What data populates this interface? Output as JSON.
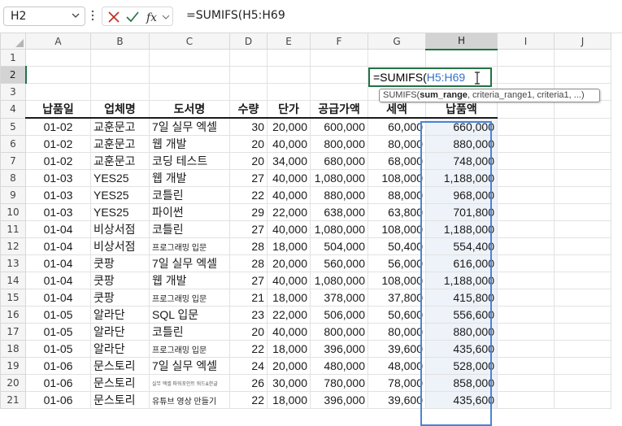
{
  "formula_bar": {
    "name_box": "H2",
    "formula": "=SUMIFS(H5:H69"
  },
  "columns": [
    "A",
    "B",
    "C",
    "D",
    "E",
    "F",
    "G",
    "H",
    "I",
    "J"
  ],
  "row_numbers": [
    "1",
    "2",
    "3",
    "4",
    "5",
    "6",
    "7",
    "8",
    "9",
    "10",
    "11",
    "12",
    "13",
    "14",
    "15",
    "16",
    "17",
    "18",
    "19",
    "20",
    "21"
  ],
  "editing_cell": {
    "address": "H2",
    "prefix": "=SUMIFS(",
    "ref": "H5:H69"
  },
  "tooltip": {
    "func": "SUMIFS(",
    "bold_arg": "sum_range",
    "rest": ", criteria_range1, criteria1, ...)"
  },
  "table": {
    "headers": [
      "납품일",
      "업체명",
      "도서명",
      "수량",
      "단가",
      "공급가액",
      "세액",
      "납품액"
    ],
    "rows": [
      [
        "01-02",
        "교훈문고",
        "7일 실무 엑셀",
        "30",
        "20,000",
        "600,000",
        "60,000",
        "660,000"
      ],
      [
        "01-02",
        "교훈문고",
        "웹 개발",
        "20",
        "40,000",
        "800,000",
        "80,000",
        "880,000"
      ],
      [
        "01-02",
        "교훈문고",
        "코딩 테스트",
        "20",
        "34,000",
        "680,000",
        "68,000",
        "748,000"
      ],
      [
        "01-03",
        "YES25",
        "웹 개발",
        "27",
        "40,000",
        "1,080,000",
        "108,000",
        "1,188,000"
      ],
      [
        "01-03",
        "YES25",
        "코틀린",
        "22",
        "40,000",
        "880,000",
        "88,000",
        "968,000"
      ],
      [
        "01-03",
        "YES25",
        "파이썬",
        "29",
        "22,000",
        "638,000",
        "63,800",
        "701,800"
      ],
      [
        "01-04",
        "비상서점",
        "코틀린",
        "27",
        "40,000",
        "1,080,000",
        "108,000",
        "1,188,000"
      ],
      [
        "01-04",
        "비상서점",
        "프로그래밍 입문",
        "28",
        "18,000",
        "504,000",
        "50,400",
        "554,400"
      ],
      [
        "01-04",
        "쿳팡",
        "7일 실무 엑셀",
        "28",
        "20,000",
        "560,000",
        "56,000",
        "616,000"
      ],
      [
        "01-04",
        "쿳팡",
        "웹 개발",
        "27",
        "40,000",
        "1,080,000",
        "108,000",
        "1,188,000"
      ],
      [
        "01-04",
        "쿳팡",
        "프로그래밍 입문",
        "21",
        "18,000",
        "378,000",
        "37,800",
        "415,800"
      ],
      [
        "01-05",
        "알라단",
        "SQL 입문",
        "23",
        "22,000",
        "506,000",
        "50,600",
        "556,600"
      ],
      [
        "01-05",
        "알라단",
        "코틀린",
        "20",
        "40,000",
        "800,000",
        "80,000",
        "880,000"
      ],
      [
        "01-05",
        "알라단",
        "프로그래밍 입문",
        "22",
        "18,000",
        "396,000",
        "39,600",
        "435,600"
      ],
      [
        "01-06",
        "문스토리",
        "7일 실무 엑셀",
        "24",
        "20,000",
        "480,000",
        "48,000",
        "528,000"
      ],
      [
        "01-06",
        "문스토리",
        "실무 엑셀 파워포인트 워드&한글",
        "26",
        "30,000",
        "780,000",
        "78,000",
        "858,000"
      ],
      [
        "01-06",
        "문스토리",
        "유튜브 영상 만들기",
        "22",
        "18,000",
        "396,000",
        "39,600",
        "435,600"
      ]
    ]
  },
  "colors": {
    "accent_green": "#217346",
    "reference_blue": "#3570c8",
    "cancel_red": "#c42b1c"
  }
}
